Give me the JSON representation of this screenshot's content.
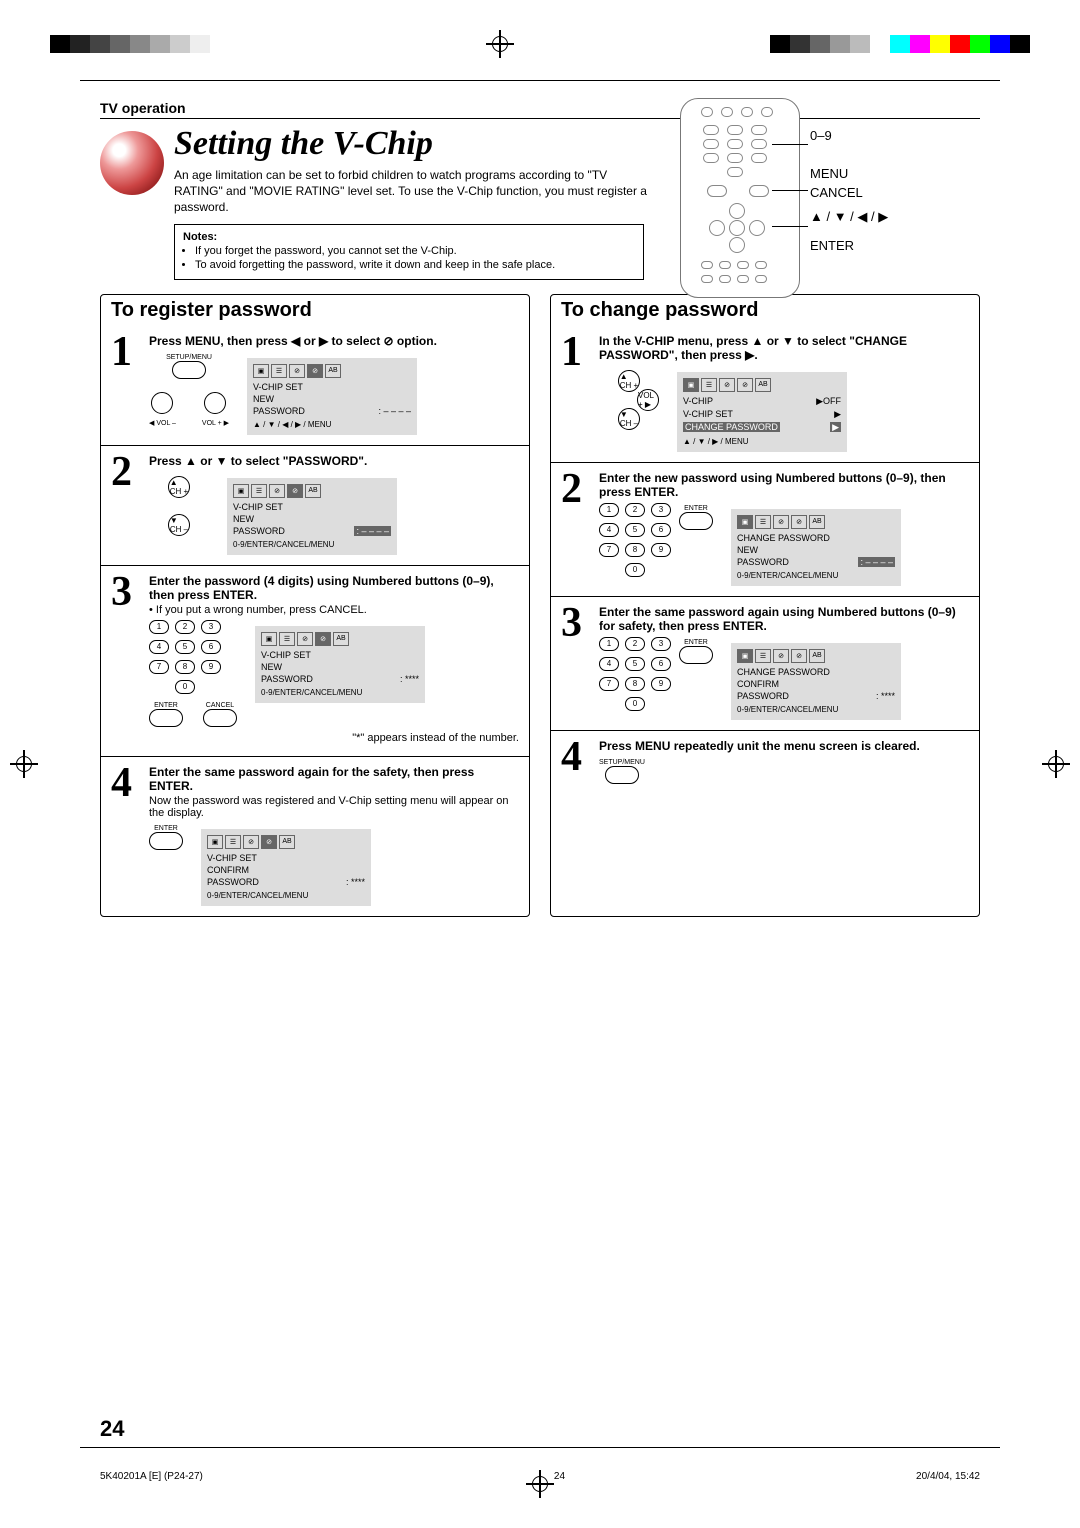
{
  "page": {
    "section_label": "TV operation",
    "title": "Setting the V-Chip",
    "intro": "An age limitation can be set to forbid children to watch programs according to \"TV RATING\" and \"MOVIE RATING\" level set. To use the V-Chip function, you must register a password.",
    "notes_heading": "Notes:",
    "notes": [
      "If you forget the password, you cannot set the V-Chip.",
      "To avoid forgetting the password, write it down and keep in the safe place."
    ],
    "page_number": "24"
  },
  "remote_labels": {
    "num": "0–9",
    "menu": "MENU",
    "cancel": "CANCEL",
    "dpad": "▲ / ▼ / ◀ / ▶",
    "enter": "ENTER"
  },
  "register": {
    "heading": "To register password",
    "steps": [
      {
        "num": "1",
        "bold": "Press MENU, then press ◀ or ▶ to select ⊘ option.",
        "osd": {
          "title": "V-CHIP SET",
          "lines": [
            [
              "NEW",
              ""
            ],
            [
              "PASSWORD",
              ": – – – –"
            ]
          ],
          "footer": "▲ / ▼ / ◀ / ▶ / MENU",
          "tab_active": 3
        }
      },
      {
        "num": "2",
        "bold": "Press ▲ or ▼ to select \"PASSWORD\".",
        "osd": {
          "title": "V-CHIP SET",
          "lines": [
            [
              "NEW",
              ""
            ],
            [
              "PASSWORD",
              ": – – – –"
            ]
          ],
          "footer": "0-9/ENTER/CANCEL/MENU",
          "highlight_pw": true,
          "tab_active": 3,
          "pw_hl": true
        }
      },
      {
        "num": "3",
        "bold": "Enter the password (4 digits) using Numbered buttons (0–9), then press ENTER.",
        "note": "If you put a wrong number, press CANCEL.",
        "osd": {
          "title": "V-CHIP SET",
          "lines": [
            [
              "NEW",
              ""
            ],
            [
              "PASSWORD",
              ": ****"
            ]
          ],
          "footer": "0-9/ENTER/CANCEL/MENU",
          "tab_active": 3
        },
        "keypad": true,
        "enter_cancel": true,
        "after_note": "\"*\" appears instead of the number."
      },
      {
        "num": "4",
        "bold": "Enter the same password again for the safety, then press ENTER.",
        "text": "Now the password was registered and V-Chip setting menu will appear on the display.",
        "osd": {
          "title": "V-CHIP SET",
          "lines": [
            [
              "CONFIRM",
              ""
            ],
            [
              "PASSWORD",
              ": ****"
            ]
          ],
          "footer": "0-9/ENTER/CANCEL/MENU",
          "tab_active": 3
        },
        "enter_only": true
      }
    ]
  },
  "change": {
    "heading": "To change password",
    "steps": [
      {
        "num": "1",
        "bold": "In the V-CHIP menu, press ▲ or ▼ to select \"CHANGE PASSWORD\", then press ▶.",
        "osd": {
          "title": "",
          "lines": [
            [
              "V-CHIP",
              "▶OFF"
            ],
            [
              "V-CHIP SET",
              "▶"
            ],
            [
              "CHANGE PASSWORD",
              "▶"
            ]
          ],
          "footer": "▲ / ▼ / ▶ / MENU",
          "tab_active": 0,
          "hl_row": 2
        }
      },
      {
        "num": "2",
        "bold": "Enter the new password using Numbered buttons (0–9), then press ENTER.",
        "osd": {
          "title": "CHANGE PASSWORD",
          "lines": [
            [
              "NEW",
              ""
            ],
            [
              "PASSWORD",
              ": – – – –"
            ]
          ],
          "footer": "0-9/ENTER/CANCEL/MENU",
          "tab_active": 0,
          "pw_hl": true
        },
        "keypad": true,
        "enter_right": true
      },
      {
        "num": "3",
        "bold": "Enter the same password again using Numbered buttons (0–9) for safety, then press ENTER.",
        "osd": {
          "title": "CHANGE PASSWORD",
          "lines": [
            [
              "CONFIRM",
              ""
            ],
            [
              "PASSWORD",
              ": ****"
            ]
          ],
          "footer": "0-9/ENTER/CANCEL/MENU",
          "tab_active": 0
        },
        "keypad": true,
        "enter_right": true
      },
      {
        "num": "4",
        "bold": "Press MENU repeatedly unit the menu screen is cleared.",
        "setup_menu_btn": true
      }
    ]
  },
  "ctrl_labels": {
    "setup_menu": "SETUP/MENU",
    "vol_minus": "VOL –",
    "vol_plus": "VOL +",
    "ch_plus": "CH +",
    "ch_minus": "CH –",
    "enter": "ENTER",
    "cancel": "CANCEL"
  },
  "colorbar": [
    "#000",
    "#333",
    "#666",
    "#999",
    "#bbb",
    "#fff",
    "#0ff",
    "#f0f",
    "#ff0",
    "#f00",
    "#0f0",
    "#00f",
    "#000"
  ],
  "footer": {
    "left": "5K40201A [E] (P24-27)",
    "mid": "24",
    "right": "20/4/04, 15:42"
  }
}
